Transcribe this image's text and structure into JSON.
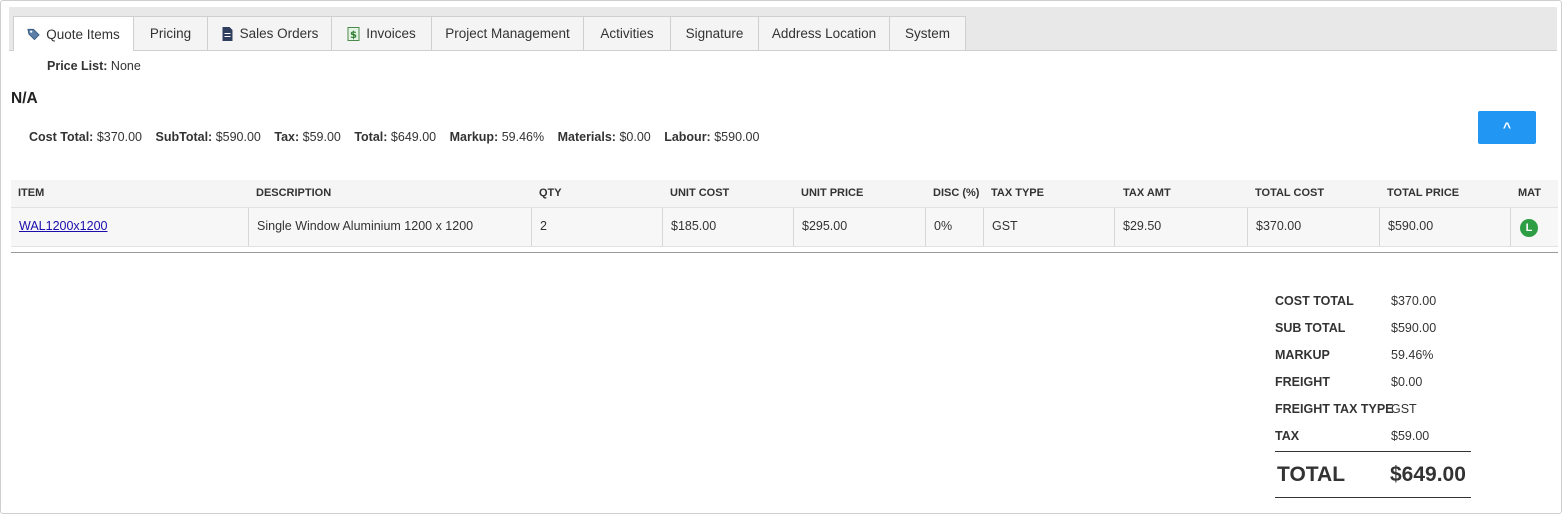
{
  "tabs": [
    {
      "label": "Quote Items",
      "icon": "tag-icon"
    },
    {
      "label": "Pricing"
    },
    {
      "label": "Sales Orders",
      "icon": "document-icon"
    },
    {
      "label": "Invoices",
      "icon": "money-icon"
    },
    {
      "label": "Project Management"
    },
    {
      "label": "Activities"
    },
    {
      "label": "Signature"
    },
    {
      "label": "Address Location"
    },
    {
      "label": "System"
    }
  ],
  "price_list": {
    "label": "Price List:",
    "value": "None"
  },
  "section_title": "N/A",
  "summary": [
    {
      "label": "Cost Total:",
      "value": "$370.00"
    },
    {
      "label": "SubTotal:",
      "value": "$590.00"
    },
    {
      "label": "Tax:",
      "value": "$59.00"
    },
    {
      "label": "Total:",
      "value": "$649.00"
    },
    {
      "label": "Markup:",
      "value": "59.46%"
    },
    {
      "label": "Materials:",
      "value": "$0.00"
    },
    {
      "label": "Labour:",
      "value": "$590.00"
    }
  ],
  "collapse_label": "^",
  "colors": {
    "accent": "#2196f3",
    "material_badge": "#2e9e44"
  },
  "table": {
    "headers": [
      "ITEM",
      "DESCRIPTION",
      "QTY",
      "UNIT COST",
      "UNIT PRICE",
      "DISC (%)",
      "TAX TYPE",
      "TAX AMT",
      "TOTAL COST",
      "TOTAL PRICE",
      "MAT"
    ],
    "rows": [
      {
        "item": "WAL1200x1200",
        "description": "Single Window Aluminium 1200 x 1200",
        "qty": "2",
        "unit_cost": "$185.00",
        "unit_price": "$295.00",
        "disc": "0%",
        "tax_type": "GST",
        "tax_amt": "$29.50",
        "total_cost": "$370.00",
        "total_price": "$590.00",
        "mat": "L"
      }
    ]
  },
  "totals": [
    {
      "label": "COST TOTAL",
      "value": "$370.00"
    },
    {
      "label": "SUB TOTAL",
      "value": "$590.00"
    },
    {
      "label": "MARKUP",
      "value": "59.46%"
    },
    {
      "label": "FREIGHT",
      "value": "$0.00"
    },
    {
      "label": "FREIGHT TAX TYPE",
      "value": "GST"
    },
    {
      "label": "TAX",
      "value": "$59.00"
    }
  ],
  "grand_total": {
    "label": "TOTAL",
    "value": "$649.00"
  }
}
